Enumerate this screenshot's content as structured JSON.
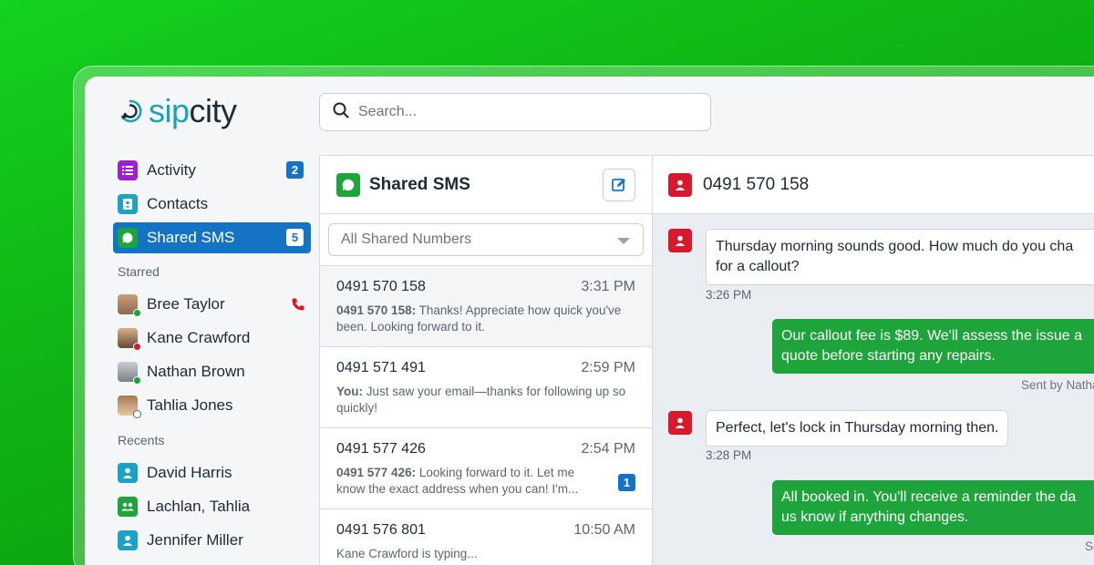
{
  "brand": {
    "logo_prefix": "sip",
    "logo_suffix": "city"
  },
  "search": {
    "placeholder": "Search..."
  },
  "sidebar": {
    "nav": [
      {
        "label": "Activity",
        "badge": "2",
        "icon": "list-icon",
        "color": "#a020d0"
      },
      {
        "label": "Contacts",
        "badge": "",
        "icon": "contact-card-icon",
        "color": "#1aa2c8"
      },
      {
        "label": "Shared SMS",
        "badge": "5",
        "icon": "chat-bubble-icon",
        "color": "#1da43a"
      }
    ],
    "starred_title": "Starred",
    "starred": [
      {
        "name": "Bree Taylor",
        "status": "online",
        "status_color": "#1da43a"
      },
      {
        "name": "Kane Crawford",
        "status": "busy",
        "status_color": "#d9182b"
      },
      {
        "name": "Nathan Brown",
        "status": "online",
        "status_color": "#1da43a"
      },
      {
        "name": "Tahlia Jones",
        "status": "offline",
        "status_color": "#ffffff"
      }
    ],
    "recents_title": "Recents",
    "recents": [
      {
        "name": "David Harris",
        "icon": "person-icon",
        "color": "#1aa2c8"
      },
      {
        "name": "Lachlan, Tahlia",
        "icon": "group-icon",
        "color": "#1da43a"
      },
      {
        "name": "Jennifer Miller",
        "icon": "person-icon",
        "color": "#1aa2c8"
      }
    ]
  },
  "middle": {
    "title": "Shared SMS",
    "filter": "All Shared Numbers",
    "conversations": [
      {
        "number": "0491 570 158",
        "time": "3:31 PM",
        "sender": "0491 570 158:",
        "text": " Thanks! Appreciate how quick you've been. Looking forward to it.",
        "badge": ""
      },
      {
        "number": "0491 571 491",
        "time": "2:59 PM",
        "sender": "You:",
        "text": " Just saw your email—thanks for following up so quickly!",
        "badge": ""
      },
      {
        "number": "0491 577 426",
        "time": "2:54 PM",
        "sender": "0491 577 426:",
        "text": " Looking forward to it. Let me know the exact address when you can! I'm...",
        "badge": "1"
      },
      {
        "number": "0491 576 801",
        "time": "10:50 AM",
        "sender": "",
        "text": "Kane Crawford is typing...",
        "badge": ""
      }
    ]
  },
  "chat": {
    "title": "0491 570 158",
    "messages": [
      {
        "dir": "in",
        "lines": [
          "Thursday morning sounds good. How much do you cha",
          "for a callout?"
        ],
        "time": "3:26 PM"
      },
      {
        "dir": "out",
        "lines": [
          "Our callout fee is $89. We'll assess the issue a",
          "quote before starting any repairs."
        ],
        "meta": "Sent by Nathan Brown • De"
      },
      {
        "dir": "in",
        "lines": [
          "Perfect, let's lock in Thursday morning then."
        ],
        "time": "3:28 PM"
      },
      {
        "dir": "out",
        "lines": [
          "All booked in. You'll receive a reminder the da",
          "us know if anything changes."
        ],
        "meta": "Sent by you • De"
      }
    ]
  },
  "colors": {
    "accent": "#1573c6",
    "brand_green": "#1da43a",
    "danger": "#d9182b"
  }
}
